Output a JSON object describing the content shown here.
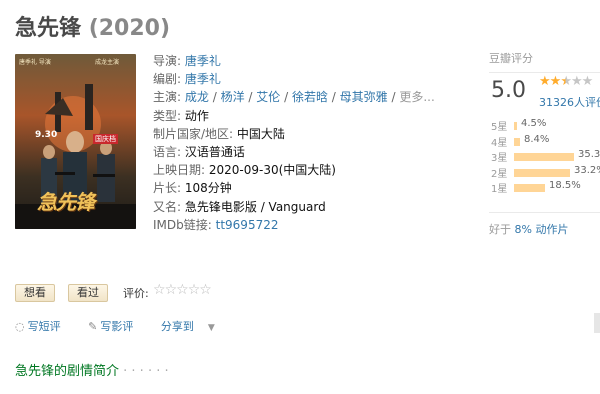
{
  "movie": {
    "title": "急先锋",
    "year": "(2020)"
  },
  "info": {
    "director": {
      "label": "导演:",
      "value": "唐季礼"
    },
    "writer": {
      "label": "编剧:",
      "value": "唐季礼"
    },
    "cast": {
      "label": "主演:",
      "names": [
        "成龙",
        "杨洋",
        "艾伦",
        "徐若晗",
        "母其弥雅"
      ],
      "more": "更多..."
    },
    "genre": {
      "label": "类型:",
      "value": "动作"
    },
    "country": {
      "label": "制片国家/地区:",
      "value": "中国大陆"
    },
    "language": {
      "label": "语言:",
      "value": "汉语普通话"
    },
    "release": {
      "label": "上映日期:",
      "value": "2020-09-30(中国大陆)"
    },
    "runtime": {
      "label": "片长:",
      "value": "108分钟"
    },
    "aka": {
      "label": "又名:",
      "value": "急先锋电影版 / Vanguard"
    },
    "imdb": {
      "label": "IMDb链接:",
      "value": "tt9695722"
    }
  },
  "poster": {
    "credit_left": "唐季礼 导演",
    "credit_right": "成龙主演",
    "badge": "国庆档",
    "date": "9.30",
    "title_art": "急先锋"
  },
  "rating": {
    "header": "豆瓣评分",
    "score": "5.0",
    "stars_filled": 2.5,
    "count": "31326人评价",
    "breakdown": [
      {
        "label": "5星",
        "percent": "4.5%",
        "value": 4.5
      },
      {
        "label": "4星",
        "percent": "8.4%",
        "value": 8.4
      },
      {
        "label": "3星",
        "percent": "35.3%",
        "value": 35.3
      },
      {
        "label": "2星",
        "percent": "33.2%",
        "value": 33.2
      },
      {
        "label": "1星",
        "percent": "18.5%",
        "value": 18.5
      }
    ],
    "better_than_prefix": "好于",
    "better_than_value": "8%",
    "better_than_genre": "动作片"
  },
  "actions": {
    "want_label": "想看",
    "seen_label": "看过",
    "rate_label": "评价:",
    "short_review": "写短评",
    "long_review": "写影评",
    "share": "分享到"
  },
  "summary": {
    "title": "急先锋的剧情简介",
    "dots": "· · · · · ·"
  },
  "colors": {
    "link": "#3377aa",
    "star": "#ffac2d",
    "bar": "#ffd596",
    "green": "#007722"
  }
}
